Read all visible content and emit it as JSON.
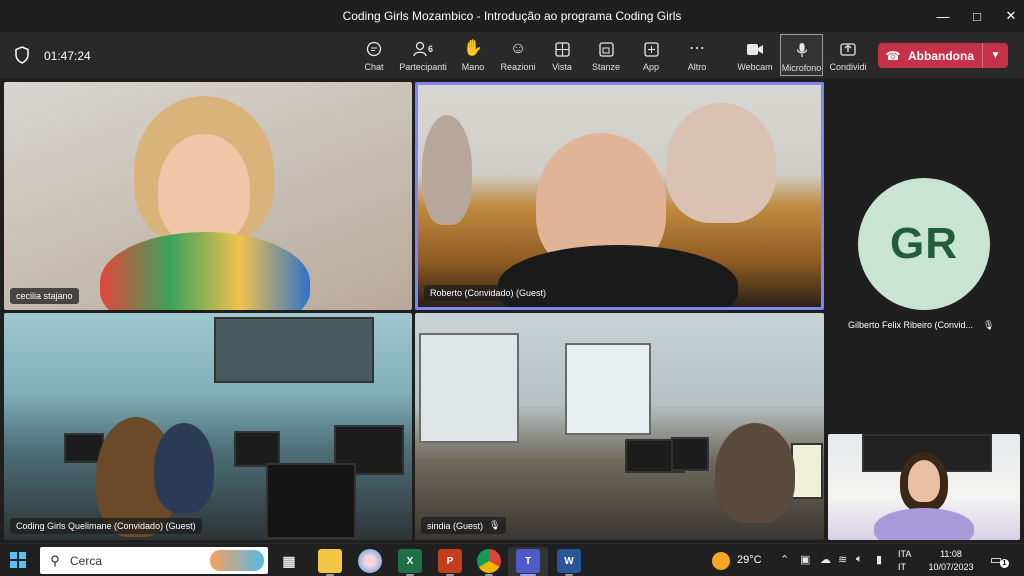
{
  "window": {
    "title": "Coding Girls Mozambico - Introdução ao programa Coding Girls",
    "minimize_icon": "minimize-icon",
    "maximize_icon": "maximize-icon",
    "close_icon": "close-icon"
  },
  "toolbar": {
    "timer": "01:47:24",
    "buttons": [
      {
        "label": "Chat",
        "icon": "chat-icon"
      },
      {
        "label": "Partecipanti",
        "icon": "people-icon",
        "badge": "6"
      },
      {
        "label": "Mano",
        "icon": "raise-hand-icon"
      },
      {
        "label": "Reazioni",
        "icon": "smiley-icon"
      },
      {
        "label": "Vista",
        "icon": "grid-icon"
      },
      {
        "label": "Stanze",
        "icon": "breakout-rooms-icon"
      },
      {
        "label": "App",
        "icon": "add-app-icon"
      },
      {
        "label": "Altro",
        "icon": "more-icon"
      },
      {
        "label": "Webcam",
        "icon": "camera-icon"
      },
      {
        "label": "Microfono",
        "icon": "microphone-icon"
      },
      {
        "label": "Condividi",
        "icon": "share-icon"
      }
    ],
    "leave_label": "Abbandona"
  },
  "participants": {
    "cecilia": "cecilia stajano",
    "roberto": "Roberto (Convidado) (Guest)",
    "quelimane": "Coding Girls Quelimane (Convidado) (Guest)",
    "sindia": "sindia (Guest)",
    "gilberto_initials": "GR",
    "gilberto_name": "Gilberto Felix Ribeiro (Convid..."
  },
  "colors": {
    "active_speaker_border": "#7f85f5",
    "leave_button": "#c4314b",
    "avatar_bg": "#cae4d3",
    "avatar_text": "#215c3b"
  },
  "taskbar": {
    "search_placeholder": "Cerca",
    "apps": [
      "task-view-icon",
      "file-explorer-icon",
      "paint-icon",
      "excel-icon",
      "powerpoint-icon",
      "chrome-icon",
      "teams-icon",
      "word-icon"
    ],
    "weather": "29°C",
    "lang_line1": "ITA",
    "lang_line2": "IT",
    "time": "11:08",
    "date": "10/07/2023",
    "notifications": "1"
  }
}
